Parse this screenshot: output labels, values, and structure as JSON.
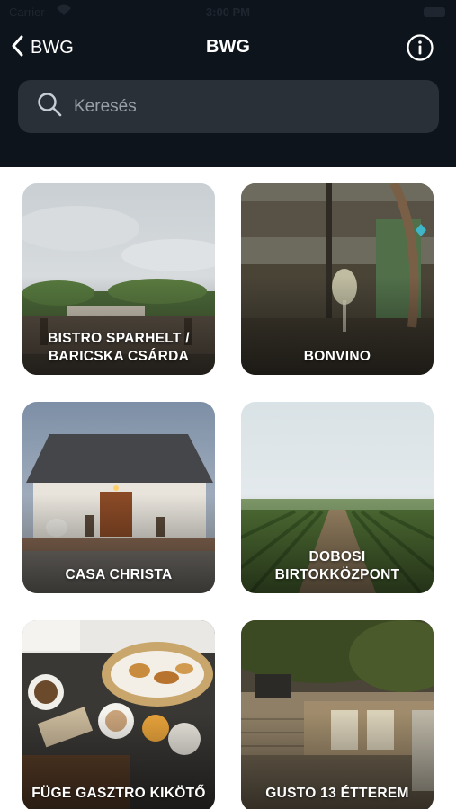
{
  "status_bar": {
    "carrier": "Carrier",
    "time": "3:00 PM"
  },
  "nav": {
    "back_label": "BWG",
    "title": "BWG",
    "back_icon": "chevron-left-icon",
    "info_icon": "info-icon"
  },
  "search": {
    "placeholder": "Keresés",
    "value": "",
    "icon": "search-icon"
  },
  "colors": {
    "header_bg": "#0e141b",
    "search_bg": "#2a3038",
    "text_light": "#ffffff",
    "placeholder": "#9aa0a8"
  },
  "places": [
    {
      "name": "BISTRO SPARHELT /\nBARICSKA CSÁRDA"
    },
    {
      "name": "BONVINO"
    },
    {
      "name": "CASA CHRISTA"
    },
    {
      "name": "DOBOSI\nBIRTOKKÖZPONT"
    },
    {
      "name": "FÜGE GASZTRO KIKÖTŐ"
    },
    {
      "name": "GUSTO 13 ÉTTEREM"
    }
  ]
}
